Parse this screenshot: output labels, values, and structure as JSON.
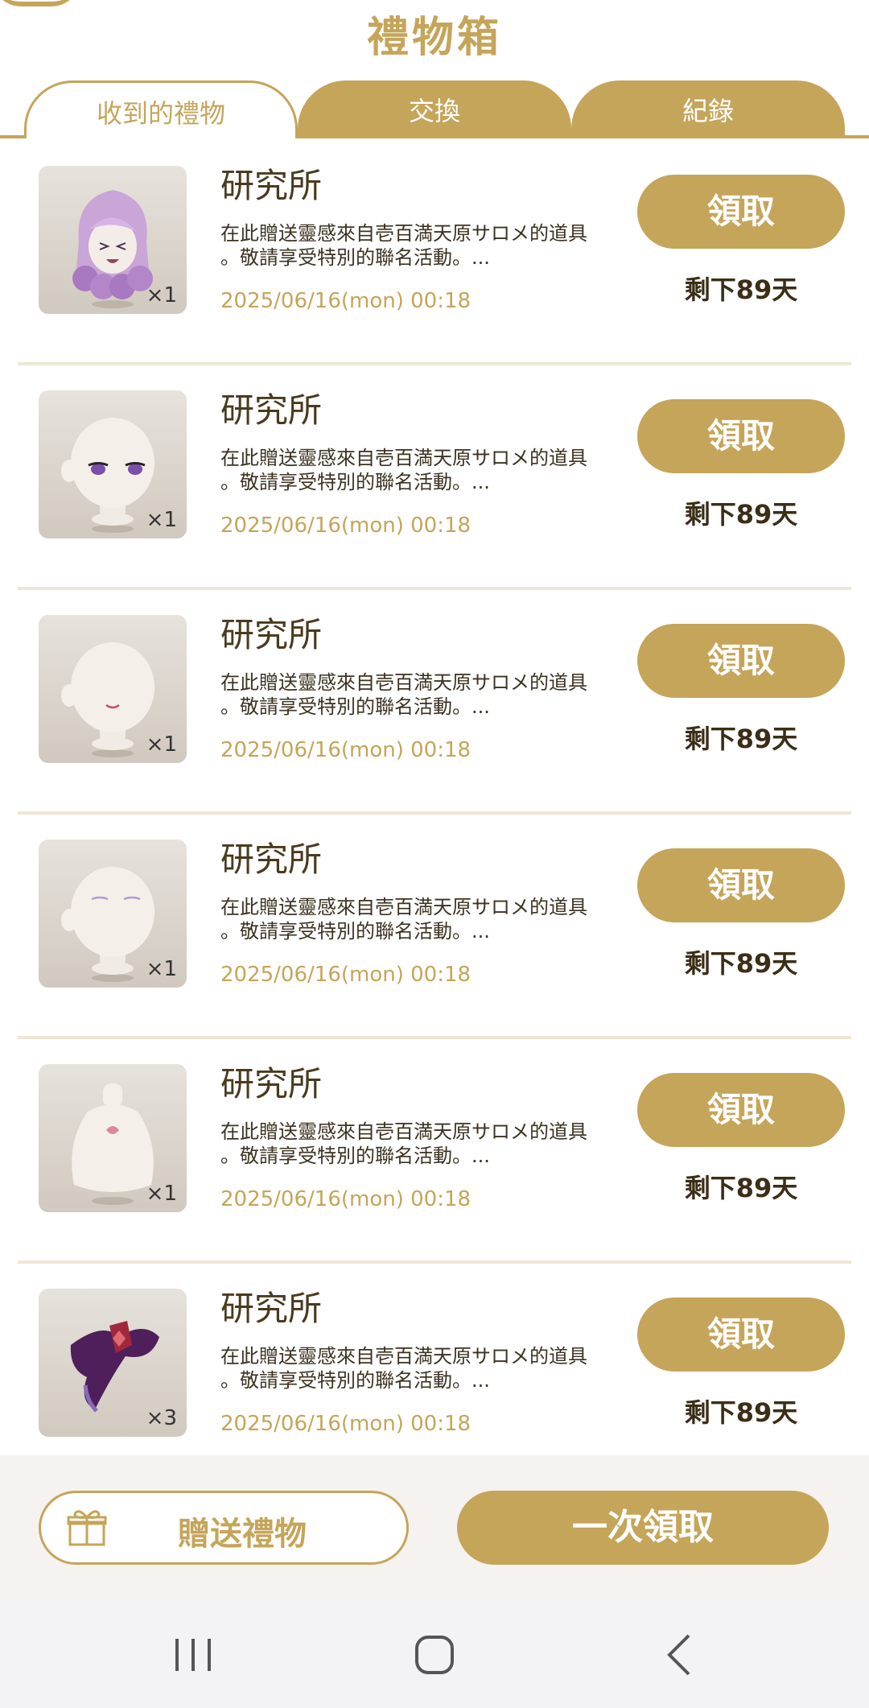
{
  "header": {
    "title": "禮物箱"
  },
  "tabs": [
    {
      "label": "收到的禮物"
    },
    {
      "label": "交換"
    },
    {
      "label": "紀錄"
    }
  ],
  "gifts": [
    {
      "sender": "研究所",
      "description_line1": "在此贈送靈感來自壱百満天原サロメ的道具",
      "description_line2": "。敬請享受特別的聯名活動。...",
      "date": "2025/06/16(mon) 00:18",
      "claim_label": "領取",
      "remaining": "剩下89天",
      "qty": "×1",
      "item_icon": "hair-icon"
    },
    {
      "sender": "研究所",
      "description_line1": "在此贈送靈感來自壱百満天原サロメ的道具",
      "description_line2": "。敬請享受特別的聯名活動。...",
      "date": "2025/06/16(mon) 00:18",
      "claim_label": "領取",
      "remaining": "剩下89天",
      "qty": "×1",
      "item_icon": "eyes-icon"
    },
    {
      "sender": "研究所",
      "description_line1": "在此贈送靈感來自壱百満天原サロメ的道具",
      "description_line2": "。敬請享受特別的聯名活動。...",
      "date": "2025/06/16(mon) 00:18",
      "claim_label": "領取",
      "remaining": "剩下89天",
      "qty": "×1",
      "item_icon": "mouth-icon"
    },
    {
      "sender": "研究所",
      "description_line1": "在此贈送靈感來自壱百満天原サロメ的道具",
      "description_line2": "。敬請享受特別的聯名活動。...",
      "date": "2025/06/16(mon) 00:18",
      "claim_label": "領取",
      "remaining": "剩下89天",
      "qty": "×1",
      "item_icon": "eyebrows-icon"
    },
    {
      "sender": "研究所",
      "description_line1": "在此贈送靈感來自壱百満天原サロメ的道具",
      "description_line2": "。敬請享受特別的聯名活動。...",
      "date": "2025/06/16(mon) 00:18",
      "claim_label": "領取",
      "remaining": "剩下89天",
      "qty": "×1",
      "item_icon": "body-tattoo-icon"
    },
    {
      "sender": "研究所",
      "description_line1": "在此贈送靈感來自壱百満天原サロメ的道具",
      "description_line2": "。敬請享受特別的聯名活動。...",
      "date": "2025/06/16(mon) 00:18",
      "claim_label": "領取",
      "remaining": "剩下89天",
      "qty": "×3",
      "item_icon": "ribbon-icon"
    }
  ],
  "footer": {
    "send_label": "贈送禮物",
    "claim_all_label": "一次領取"
  },
  "colors": {
    "accent": "#c5a55a",
    "divider": "#efe6d4",
    "footer_bg": "#f5f2ef"
  },
  "navbar": {
    "icons": [
      "recent-apps-icon",
      "home-icon",
      "back-icon"
    ]
  }
}
